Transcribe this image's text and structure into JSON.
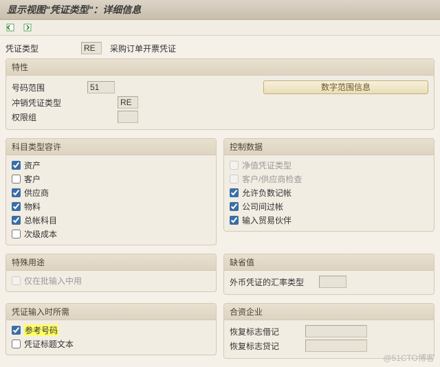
{
  "title": "显示视图\"凭证类型\"：详细信息",
  "header": {
    "label_doc_type": "凭证类型",
    "doc_type_value": "RE",
    "doc_type_desc": "采购订单开票凭证"
  },
  "group_properties": {
    "title": "特性",
    "row_numrange_label": "号码范围",
    "row_numrange_value": "51",
    "btn_numrange_info": "数字范围信息",
    "row_reverse_label": "冲销凭证类型",
    "row_reverse_value": "RE",
    "row_auth_label": "权限组",
    "row_auth_value": ""
  },
  "group_account_types": {
    "title": "科目类型容许",
    "items": [
      {
        "label": "资产",
        "checked": true,
        "enabled": true
      },
      {
        "label": "客户",
        "checked": false,
        "enabled": true
      },
      {
        "label": "供应商",
        "checked": true,
        "enabled": true
      },
      {
        "label": "物料",
        "checked": true,
        "enabled": true
      },
      {
        "label": "总帐科目",
        "checked": true,
        "enabled": true
      },
      {
        "label": "次级成本",
        "checked": false,
        "enabled": true
      }
    ]
  },
  "group_control": {
    "title": "控制数据",
    "items": [
      {
        "label": "净值凭证类型",
        "checked": false,
        "enabled": false
      },
      {
        "label": "客户/供应商检查",
        "checked": false,
        "enabled": false
      },
      {
        "label": "允许负数记帐",
        "checked": true,
        "enabled": true
      },
      {
        "label": "公司间过帐",
        "checked": true,
        "enabled": true
      },
      {
        "label": "输入贸易伙伴",
        "checked": true,
        "enabled": true
      }
    ]
  },
  "group_special": {
    "title": "特殊用途",
    "items": [
      {
        "label": "仅在批输入中用",
        "checked": false,
        "enabled": false
      }
    ]
  },
  "group_default": {
    "title": "缺省值",
    "row_fxtype_label": "外币凭证的汇率类型",
    "row_fxtype_value": ""
  },
  "group_required": {
    "title": "凭证输入时所需",
    "items": [
      {
        "label": "参考号码",
        "checked": true,
        "enabled": true,
        "highlight": true
      },
      {
        "label": "凭证标题文本",
        "checked": false,
        "enabled": true
      }
    ]
  },
  "group_jv": {
    "title": "合资企业",
    "row1_label": "恢复标志借记",
    "row1_value": "",
    "row2_label": "恢复标志贷记",
    "row2_value": ""
  },
  "watermark": "@51CTO博客"
}
